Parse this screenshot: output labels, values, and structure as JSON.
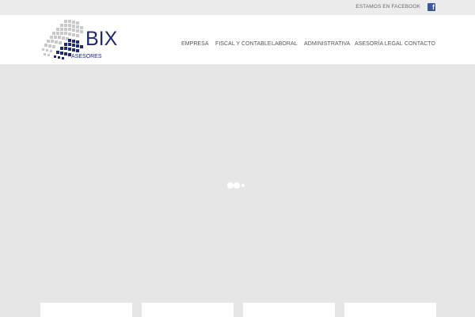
{
  "topbar": {
    "facebook_text": "ESTAMOS EN FACEBOOK",
    "facebook_icon": "facebook-icon"
  },
  "logo": {
    "brand": "BIX",
    "subtitle": "ASESORES",
    "brand_color": "#1e2a78"
  },
  "nav": {
    "items": [
      {
        "label": "EMPRESA"
      },
      {
        "label": "FISCAL Y CONTABLE"
      },
      {
        "label": "LABORAL"
      },
      {
        "label": "ADMINISTRATIVA"
      },
      {
        "label": "ASESORÍA LEGAL"
      },
      {
        "label": "CONTACTO"
      }
    ]
  },
  "hero": {
    "loader_icon": "loading-dots-icon"
  }
}
